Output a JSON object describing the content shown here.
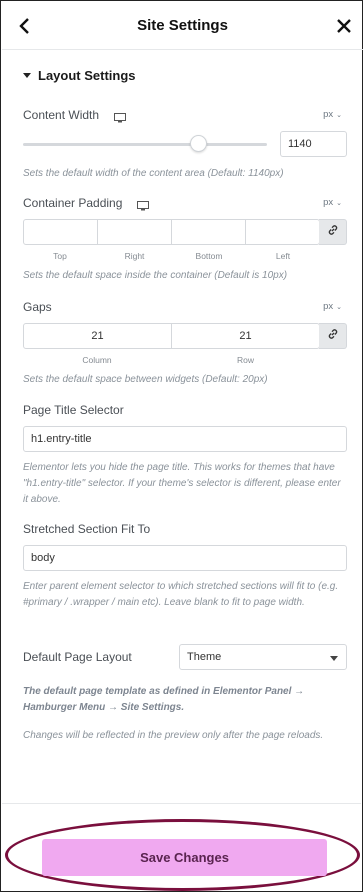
{
  "header": {
    "title": "Site Settings",
    "back_icon": "chevron-left-icon",
    "close_icon": "close-icon"
  },
  "section": {
    "title": "Layout Settings"
  },
  "content_width": {
    "label": "Content Width",
    "unit": "px",
    "slider_fraction": 0.72,
    "value": "1140",
    "description": "Sets the default width of the content area (Default: 1140px)"
  },
  "container_padding": {
    "label": "Container Padding",
    "unit": "px",
    "fields": [
      {
        "label": "Top",
        "value": ""
      },
      {
        "label": "Right",
        "value": ""
      },
      {
        "label": "Bottom",
        "value": ""
      },
      {
        "label": "Left",
        "value": ""
      }
    ],
    "description": "Sets the default space inside the container (Default is 10px)"
  },
  "gaps": {
    "label": "Gaps",
    "unit": "px",
    "fields": [
      {
        "label": "Column",
        "value": "21"
      },
      {
        "label": "Row",
        "value": "21"
      }
    ],
    "description": "Sets the default space between widgets (Default: 20px)"
  },
  "page_title_selector": {
    "label": "Page Title Selector",
    "value": "h1.entry-title",
    "description": "Elementor lets you hide the page title. This works for themes that have \"h1.entry-title\" selector. If your theme's selector is different, please enter it above."
  },
  "stretched_section": {
    "label": "Stretched Section Fit To",
    "value": "body",
    "description": "Enter parent element selector to which stretched sections will fit to (e.g. #primary / .wrapper / main etc). Leave blank to fit to page width."
  },
  "default_page_layout": {
    "label": "Default Page Layout",
    "value": "Theme",
    "note_bold": "The default page template as defined in Elementor Panel → Hamburger Menu → Site Settings.",
    "note": "Changes will be reflected in the preview only after the page reloads."
  },
  "footer": {
    "save_label": "Save Changes",
    "button_color": "#f0a9f0",
    "highlight_color": "#7a0f3d"
  }
}
